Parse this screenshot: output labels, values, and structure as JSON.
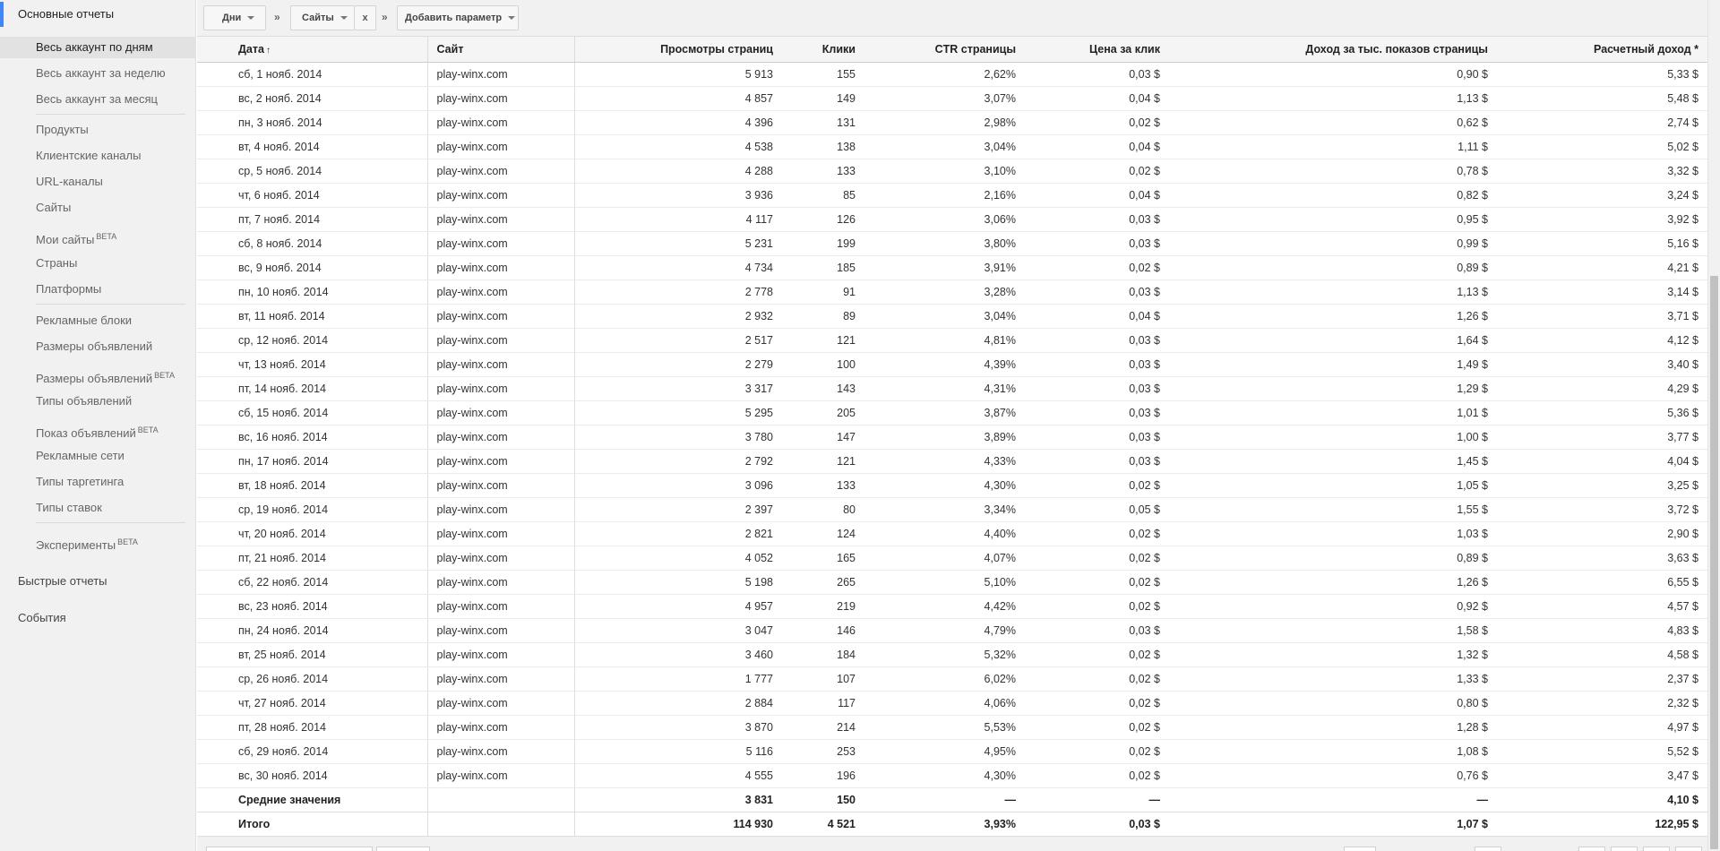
{
  "sidebar": {
    "main_section": "Основные отчеты",
    "items": [
      {
        "label": "Весь аккаунт по дням",
        "beta": ""
      },
      {
        "label": "Весь аккаунт за неделю",
        "beta": ""
      },
      {
        "label": "Весь аккаунт за месяц",
        "beta": ""
      },
      {
        "label": "Продукты",
        "beta": ""
      },
      {
        "label": "Клиентские каналы",
        "beta": ""
      },
      {
        "label": "URL-каналы",
        "beta": ""
      },
      {
        "label": "Сайты",
        "beta": ""
      },
      {
        "label": "Мои сайты",
        "beta": "BETA"
      },
      {
        "label": "Страны",
        "beta": ""
      },
      {
        "label": "Платформы",
        "beta": ""
      },
      {
        "label": "Рекламные блоки",
        "beta": ""
      },
      {
        "label": "Размеры объявлений",
        "beta": ""
      },
      {
        "label": "Размеры объявлений",
        "beta": "BETA"
      },
      {
        "label": "Типы объявлений",
        "beta": ""
      },
      {
        "label": "Показ объявлений",
        "beta": "BETA"
      },
      {
        "label": "Рекламные сети",
        "beta": ""
      },
      {
        "label": "Типы таргетинга",
        "beta": ""
      },
      {
        "label": "Типы ставок",
        "beta": ""
      },
      {
        "label": "Эксперименты",
        "beta": "BETA"
      }
    ],
    "quick_reports": "Быстрые отчеты",
    "events": "События"
  },
  "toolbar": {
    "period": "Дни",
    "separator": "»",
    "dimension": "Сайты",
    "remove": "x",
    "add_param": "Добавить параметр"
  },
  "table": {
    "columns": [
      "Дата",
      "Сайт",
      "Просмотры страниц",
      "Клики",
      "CTR страницы",
      "Цена за клик",
      "Доход за тыс. показов страницы",
      "Расчетный доход *"
    ],
    "sort_indicator": "↑",
    "rows": [
      [
        "сб, 1 нояб. 2014",
        "play-winx.com",
        "5 913",
        "155",
        "2,62%",
        "0,03 $",
        "0,90 $",
        "5,33 $"
      ],
      [
        "вс, 2 нояб. 2014",
        "play-winx.com",
        "4 857",
        "149",
        "3,07%",
        "0,04 $",
        "1,13 $",
        "5,48 $"
      ],
      [
        "пн, 3 нояб. 2014",
        "play-winx.com",
        "4 396",
        "131",
        "2,98%",
        "0,02 $",
        "0,62 $",
        "2,74 $"
      ],
      [
        "вт, 4 нояб. 2014",
        "play-winx.com",
        "4 538",
        "138",
        "3,04%",
        "0,04 $",
        "1,11 $",
        "5,02 $"
      ],
      [
        "ср, 5 нояб. 2014",
        "play-winx.com",
        "4 288",
        "133",
        "3,10%",
        "0,02 $",
        "0,78 $",
        "3,32 $"
      ],
      [
        "чт, 6 нояб. 2014",
        "play-winx.com",
        "3 936",
        "85",
        "2,16%",
        "0,04 $",
        "0,82 $",
        "3,24 $"
      ],
      [
        "пт, 7 нояб. 2014",
        "play-winx.com",
        "4 117",
        "126",
        "3,06%",
        "0,03 $",
        "0,95 $",
        "3,92 $"
      ],
      [
        "сб, 8 нояб. 2014",
        "play-winx.com",
        "5 231",
        "199",
        "3,80%",
        "0,03 $",
        "0,99 $",
        "5,16 $"
      ],
      [
        "вс, 9 нояб. 2014",
        "play-winx.com",
        "4 734",
        "185",
        "3,91%",
        "0,02 $",
        "0,89 $",
        "4,21 $"
      ],
      [
        "пн, 10 нояб. 2014",
        "play-winx.com",
        "2 778",
        "91",
        "3,28%",
        "0,03 $",
        "1,13 $",
        "3,14 $"
      ],
      [
        "вт, 11 нояб. 2014",
        "play-winx.com",
        "2 932",
        "89",
        "3,04%",
        "0,04 $",
        "1,26 $",
        "3,71 $"
      ],
      [
        "ср, 12 нояб. 2014",
        "play-winx.com",
        "2 517",
        "121",
        "4,81%",
        "0,03 $",
        "1,64 $",
        "4,12 $"
      ],
      [
        "чт, 13 нояб. 2014",
        "play-winx.com",
        "2 279",
        "100",
        "4,39%",
        "0,03 $",
        "1,49 $",
        "3,40 $"
      ],
      [
        "пт, 14 нояб. 2014",
        "play-winx.com",
        "3 317",
        "143",
        "4,31%",
        "0,03 $",
        "1,29 $",
        "4,29 $"
      ],
      [
        "сб, 15 нояб. 2014",
        "play-winx.com",
        "5 295",
        "205",
        "3,87%",
        "0,03 $",
        "1,01 $",
        "5,36 $"
      ],
      [
        "вс, 16 нояб. 2014",
        "play-winx.com",
        "3 780",
        "147",
        "3,89%",
        "0,03 $",
        "1,00 $",
        "3,77 $"
      ],
      [
        "пн, 17 нояб. 2014",
        "play-winx.com",
        "2 792",
        "121",
        "4,33%",
        "0,03 $",
        "1,45 $",
        "4,04 $"
      ],
      [
        "вт, 18 нояб. 2014",
        "play-winx.com",
        "3 096",
        "133",
        "4,30%",
        "0,02 $",
        "1,05 $",
        "3,25 $"
      ],
      [
        "ср, 19 нояб. 2014",
        "play-winx.com",
        "2 397",
        "80",
        "3,34%",
        "0,05 $",
        "1,55 $",
        "3,72 $"
      ],
      [
        "чт, 20 нояб. 2014",
        "play-winx.com",
        "2 821",
        "124",
        "4,40%",
        "0,02 $",
        "1,03 $",
        "2,90 $"
      ],
      [
        "пт, 21 нояб. 2014",
        "play-winx.com",
        "4 052",
        "165",
        "4,07%",
        "0,02 $",
        "0,89 $",
        "3,63 $"
      ],
      [
        "сб, 22 нояб. 2014",
        "play-winx.com",
        "5 198",
        "265",
        "5,10%",
        "0,02 $",
        "1,26 $",
        "6,55 $"
      ],
      [
        "вс, 23 нояб. 2014",
        "play-winx.com",
        "4 957",
        "219",
        "4,42%",
        "0,02 $",
        "0,92 $",
        "4,57 $"
      ],
      [
        "пн, 24 нояб. 2014",
        "play-winx.com",
        "3 047",
        "146",
        "4,79%",
        "0,03 $",
        "1,58 $",
        "4,83 $"
      ],
      [
        "вт, 25 нояб. 2014",
        "play-winx.com",
        "3 460",
        "184",
        "5,32%",
        "0,02 $",
        "1,32 $",
        "4,58 $"
      ],
      [
        "ср, 26 нояб. 2014",
        "play-winx.com",
        "1 777",
        "107",
        "6,02%",
        "0,02 $",
        "1,33 $",
        "2,37 $"
      ],
      [
        "чт, 27 нояб. 2014",
        "play-winx.com",
        "2 884",
        "117",
        "4,06%",
        "0,02 $",
        "0,80 $",
        "2,32 $"
      ],
      [
        "пт, 28 нояб. 2014",
        "play-winx.com",
        "3 870",
        "214",
        "5,53%",
        "0,02 $",
        "1,28 $",
        "4,97 $"
      ],
      [
        "сб, 29 нояб. 2014",
        "play-winx.com",
        "5 116",
        "253",
        "4,95%",
        "0,02 $",
        "1,08 $",
        "5,52 $"
      ],
      [
        "вс, 30 нояб. 2014",
        "play-winx.com",
        "4 555",
        "196",
        "4,30%",
        "0,02 $",
        "0,76 $",
        "3,47 $"
      ]
    ],
    "averages": [
      "Средние значения",
      "",
      "3 831",
      "150",
      "—",
      "—",
      "—",
      "4,10 $"
    ],
    "totals": [
      "Итого",
      "",
      "114 930",
      "4 521",
      "3,93%",
      "0,03 $",
      "1,07 $",
      "122,95 $"
    ]
  }
}
